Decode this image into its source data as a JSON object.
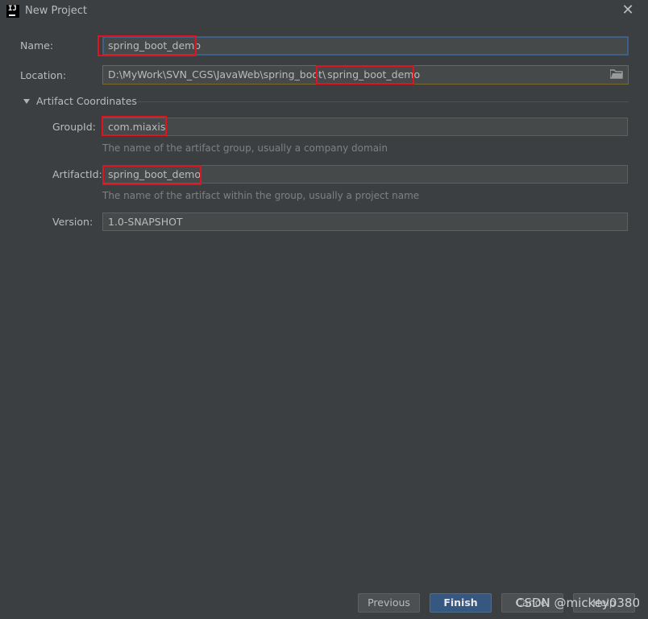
{
  "window": {
    "title": "New Project",
    "icon_text": "IJ"
  },
  "form": {
    "name_label": "Name:",
    "name_value": "spring_boot_demo",
    "location_label": "Location:",
    "location_prefix": "D:\\MyWork\\SVN_CGS\\JavaWeb\\spring_boot\\",
    "location_suffix": "spring_boot_demo",
    "section_title": "Artifact Coordinates",
    "groupid_label": "GroupId:",
    "groupid_value": "com.miaxis",
    "groupid_hint": "The name of the artifact group, usually a company domain",
    "artifactid_label": "ArtifactId:",
    "artifactid_value": "spring_boot_demo",
    "artifactid_hint": "The name of the artifact within the group, usually a project name",
    "version_label": "Version:",
    "version_value": "1.0-SNAPSHOT"
  },
  "buttons": {
    "previous": "Previous",
    "finish": "Finish",
    "cancel": "Cancel",
    "help": "Help"
  },
  "watermark": "CSDN @mickey0380",
  "colors": {
    "highlight": "#e0141e",
    "focus_border": "#3d6185",
    "primary_button": "#365880"
  },
  "icons": {
    "close": "close-icon",
    "folder": "folder-icon",
    "expand": "triangle-down-icon"
  }
}
